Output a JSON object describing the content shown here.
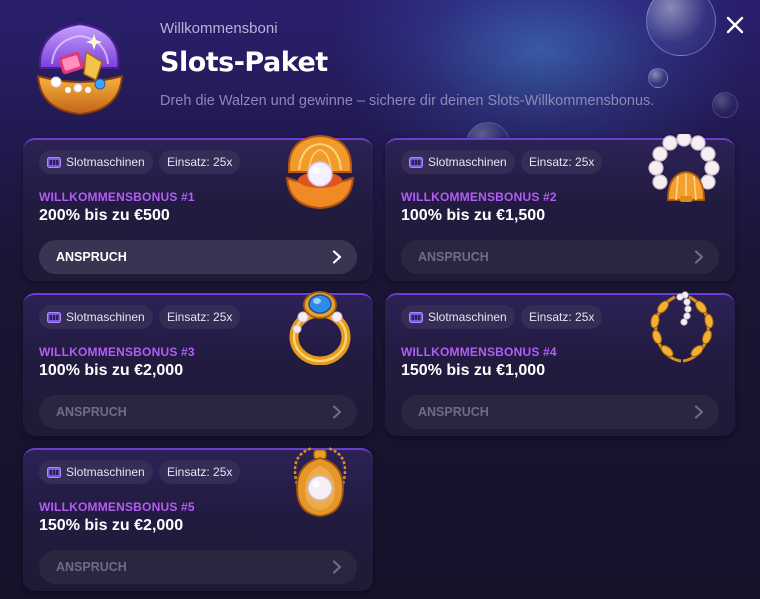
{
  "header": {
    "kicker": "Willkommensboni",
    "title": "Slots-Paket",
    "subtitle": "Dreh die Walzen und gewinne – sichere dir deinen Slots-Willkommensbonus."
  },
  "icons": {
    "close": "close-icon",
    "header": "treasure-shell-icon",
    "slot": "slot-machine-icon",
    "chevron": "chevron-right-icon"
  },
  "colors": {
    "accent": "#b45cf5",
    "card_border": "#6a3fd0",
    "button_active": "#3a3452",
    "button_disabled": "#2b2640"
  },
  "cards": [
    {
      "category": "Slotmaschinen",
      "wager": "Einsatz: 25x",
      "label": "WILLKOMMENSBONUS #1",
      "value": "200% bis zu €500",
      "cta": "ANSPRUCH",
      "enabled": true,
      "art": "pearl-shell-icon"
    },
    {
      "category": "Slotmaschinen",
      "wager": "Einsatz: 25x",
      "label": "WILLKOMMENSBONUS #2",
      "value": "100% bis zu €1,500",
      "cta": "ANSPRUCH",
      "enabled": false,
      "art": "pearl-bracelet-icon"
    },
    {
      "category": "Slotmaschinen",
      "wager": "Einsatz: 25x",
      "label": "WILLKOMMENSBONUS #3",
      "value": "100% bis zu €2,000",
      "cta": "ANSPRUCH",
      "enabled": false,
      "art": "sapphire-ring-icon"
    },
    {
      "category": "Slotmaschinen",
      "wager": "Einsatz: 25x",
      "label": "WILLKOMMENSBONUS #4",
      "value": "150% bis zu €1,000",
      "cta": "ANSPRUCH",
      "enabled": false,
      "art": "laurel-wreath-icon"
    },
    {
      "category": "Slotmaschinen",
      "wager": "Einsatz: 25x",
      "label": "WILLKOMMENSBONUS #5",
      "value": "150% bis zu €2,000",
      "cta": "ANSPRUCH",
      "enabled": false,
      "art": "pearl-pendant-icon"
    }
  ]
}
